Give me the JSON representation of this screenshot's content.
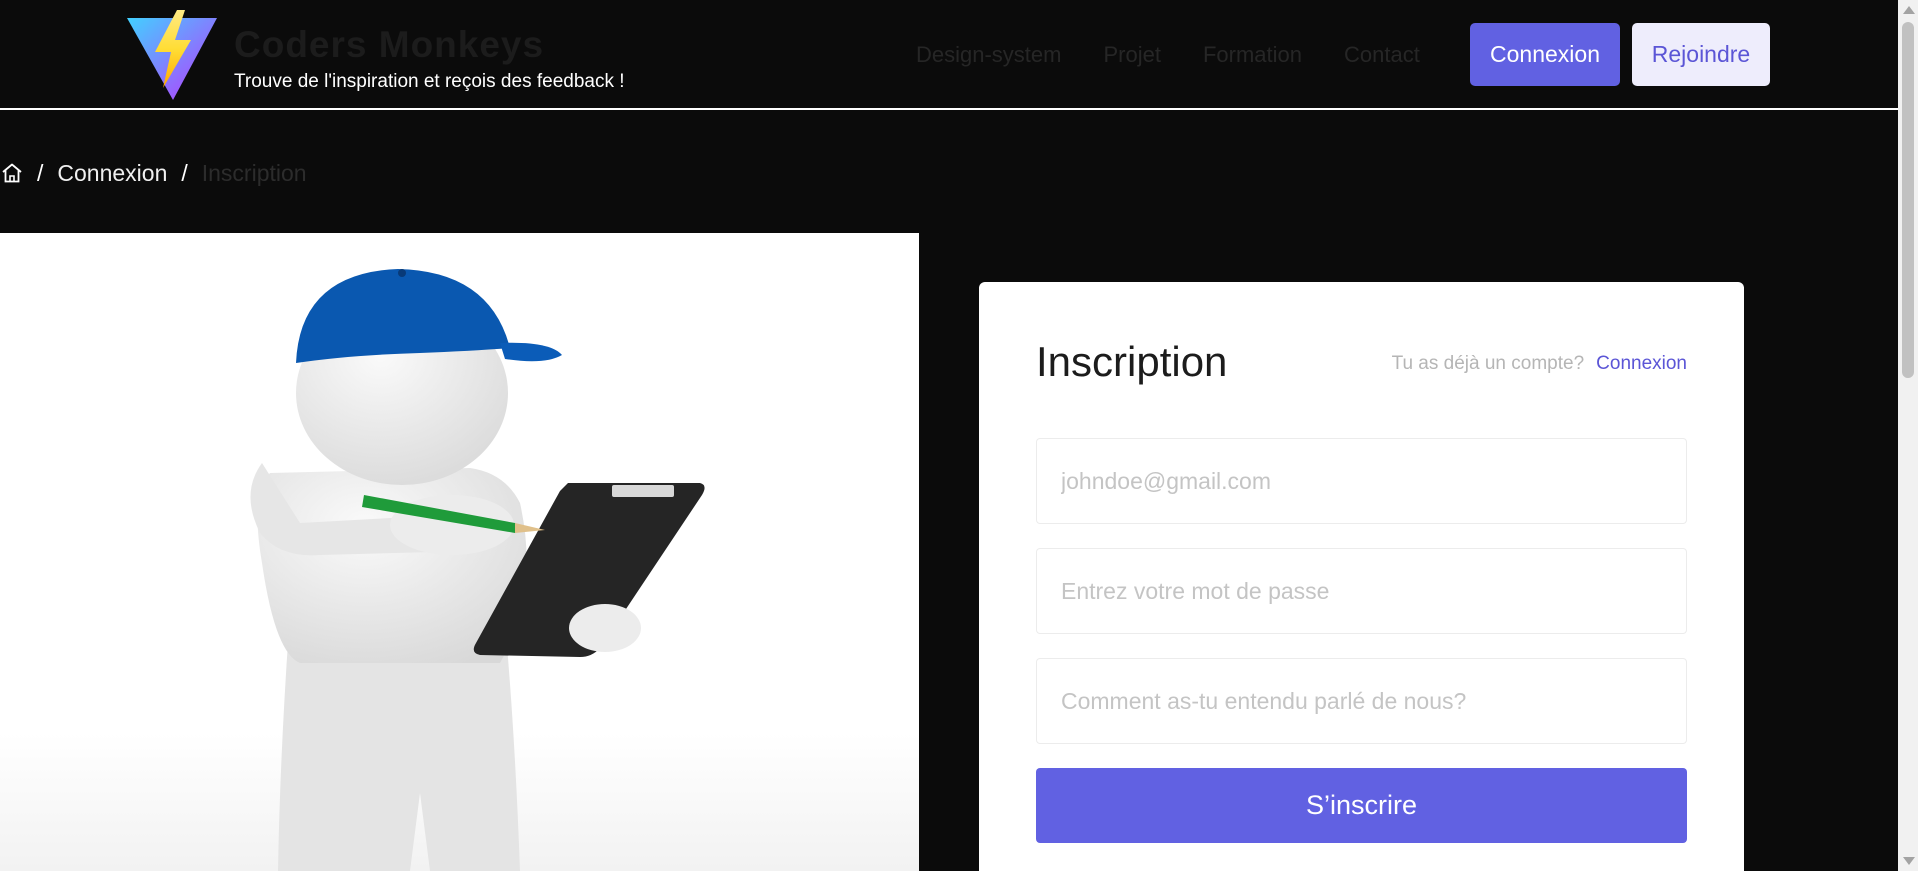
{
  "brand": {
    "name": "Coders Monkeys",
    "tagline": "Trouve de l'inspiration et reçois des feedback !",
    "logo_icon": "lightning-logo-icon"
  },
  "nav": {
    "items": [
      {
        "label": "Design-system"
      },
      {
        "label": "Projet"
      },
      {
        "label": "Formation"
      },
      {
        "label": "Contact"
      }
    ],
    "login_label": "Connexion",
    "join_label": "Rejoindre"
  },
  "breadcrumb": {
    "home_icon": "home-icon",
    "separator": "/",
    "items": [
      {
        "label": "Connexion"
      },
      {
        "label": "Inscription"
      }
    ]
  },
  "form": {
    "title": "Inscription",
    "hint_text": "Tu as déjà un compte?",
    "hint_link": "Connexion",
    "email_placeholder": "johndoe@gmail.com",
    "password_placeholder": "Entrez votre mot de passe",
    "source_placeholder": "Comment as-tu entendu parlé de nous?",
    "submit_label": "S’inscrire"
  },
  "colors": {
    "accent": "#6161e2",
    "background": "#0b0b0b",
    "secondary_button": "#eeedfc"
  }
}
